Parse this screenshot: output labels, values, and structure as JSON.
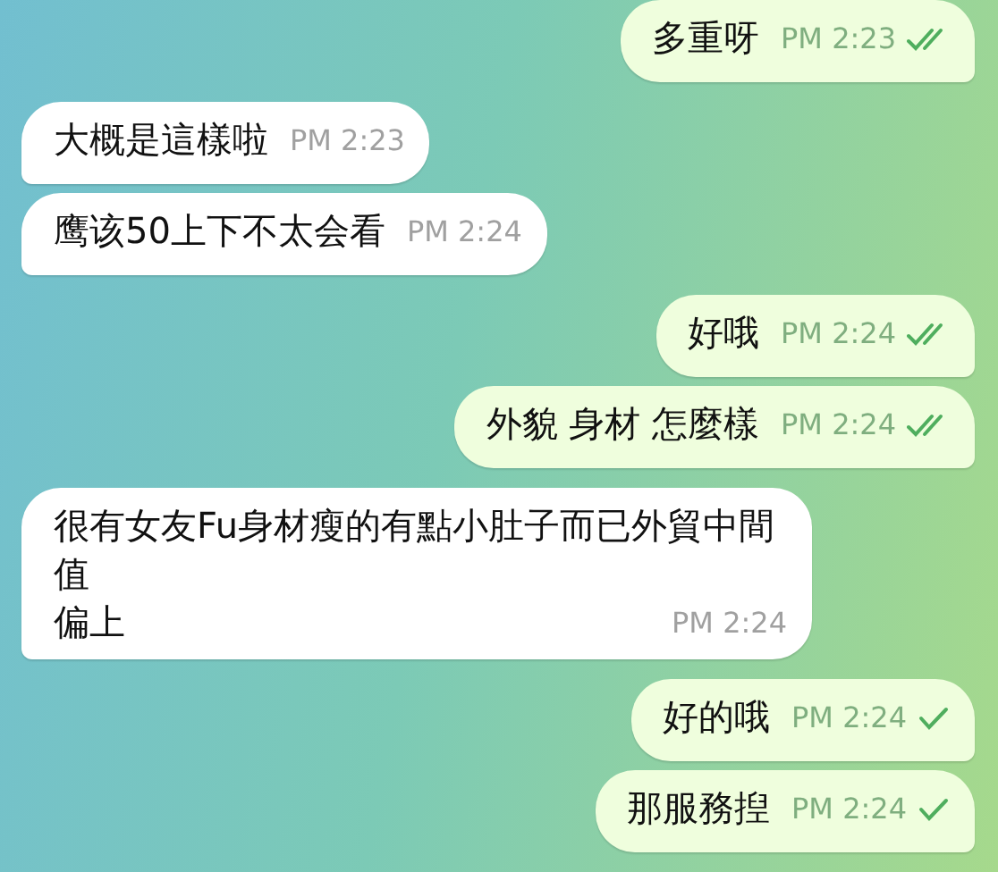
{
  "messages": [
    {
      "kind": "outgoing",
      "paragraphs": [
        "多重呀"
      ],
      "time": "PM 2:23",
      "read": true
    },
    {
      "kind": "incoming",
      "paragraphs": [
        "大概是這樣啦"
      ],
      "time": "PM 2:23"
    },
    {
      "kind": "incoming",
      "paragraphs": [
        "鹰该50上下不太会看"
      ],
      "time": "PM 2:24"
    },
    {
      "kind": "outgoing",
      "paragraphs": [
        "好哦"
      ],
      "time": "PM 2:24",
      "read": true
    },
    {
      "kind": "outgoing",
      "paragraphs": [
        "外貌 身材 怎麼樣"
      ],
      "time": "PM 2:24",
      "read": true
    },
    {
      "kind": "incoming",
      "paragraphs": [
        "很有女友Fu身材瘦的有點小肚子而已外貿中間值",
        "偏上"
      ],
      "time": "PM 2:24"
    },
    {
      "kind": "outgoing",
      "paragraphs": [
        "好的哦"
      ],
      "time": "PM 2:24",
      "read": false
    },
    {
      "kind": "outgoing",
      "paragraphs": [
        "那服務揑"
      ],
      "time": "PM 2:24",
      "read": false
    }
  ]
}
